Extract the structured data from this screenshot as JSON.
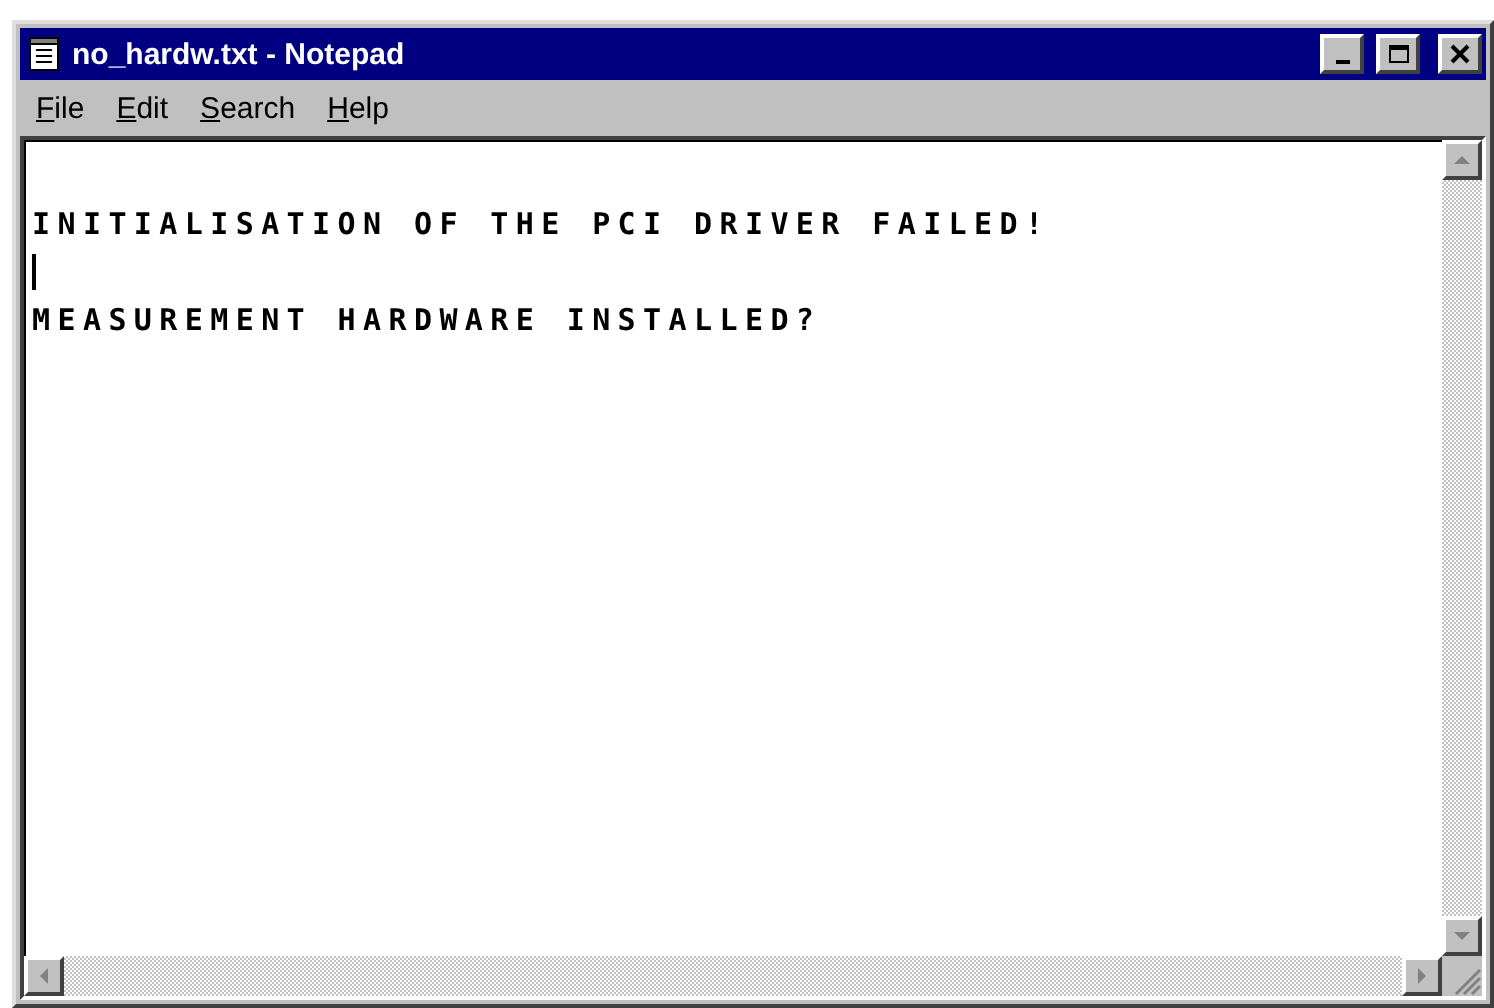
{
  "window": {
    "title": "no_hardw.txt - Notepad"
  },
  "menu": [
    {
      "label": "File"
    },
    {
      "label": "Edit"
    },
    {
      "label": "Search"
    },
    {
      "label": "Help"
    }
  ],
  "document": {
    "lines": [
      "INITIALISATION OF THE PCI DRIVER FAILED!",
      "MEASUREMENT HARDWARE INSTALLED?"
    ]
  }
}
